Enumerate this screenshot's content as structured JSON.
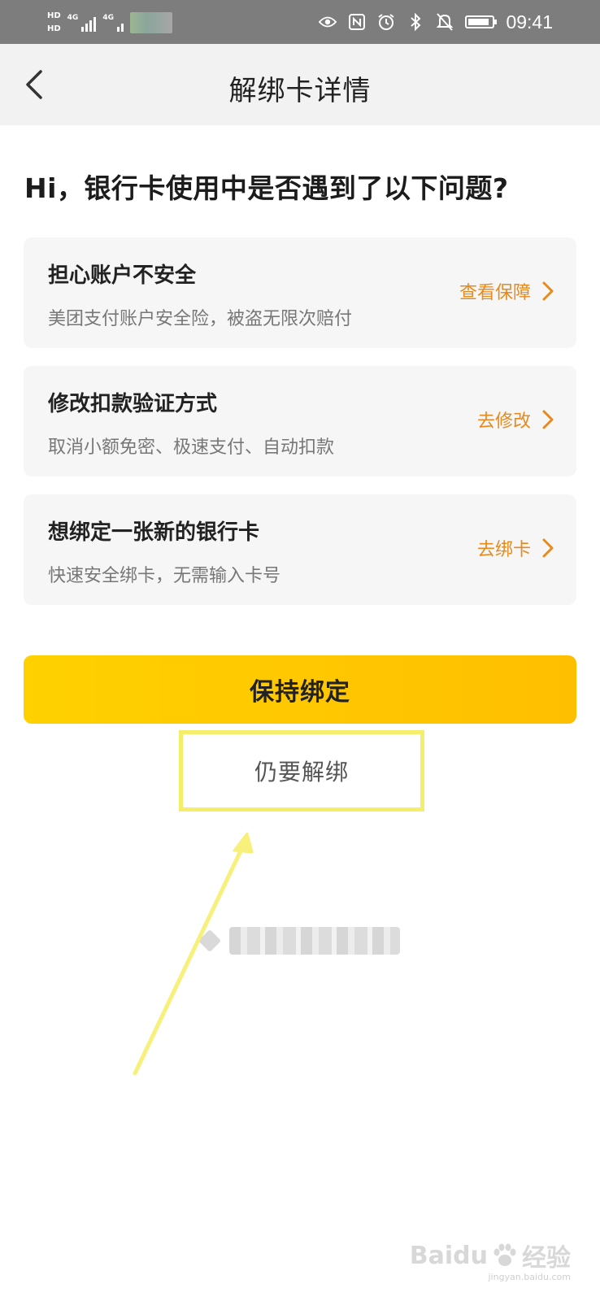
{
  "status_bar": {
    "hd_top": "HD",
    "hd_bottom": "HD",
    "net1": "4G",
    "net2": "4G",
    "time": "09:41",
    "battery_level": 0.9,
    "icons": [
      "eye-icon",
      "nfc-icon",
      "alarm-icon",
      "bluetooth-icon",
      "mute-icon",
      "battery-icon"
    ]
  },
  "header": {
    "title": "解绑卡详情",
    "back_icon": "chevron-left-icon"
  },
  "question": "Hi，银行卡使用中是否遇到了以下问题?",
  "options": [
    {
      "title": "担心账户不安全",
      "subtitle": "美团支付账户安全险，被盗无限次赔付",
      "action": "查看保障"
    },
    {
      "title": "修改扣款验证方式",
      "subtitle": "取消小额免密、极速支付、自动扣款",
      "action": "去修改"
    },
    {
      "title": "想绑定一张新的银行卡",
      "subtitle": "快速安全绑卡，无需输入卡号",
      "action": "去绑卡"
    }
  ],
  "buttons": {
    "keep": "保持绑定",
    "unbind": "仍要解绑"
  },
  "colors": {
    "accent": "#ffc800",
    "action_text": "#e8891c",
    "highlight": "#f5ee6a"
  },
  "watermark": {
    "brand": "Baidu",
    "label": "经验",
    "sub": "jingyan.baidu.com"
  }
}
